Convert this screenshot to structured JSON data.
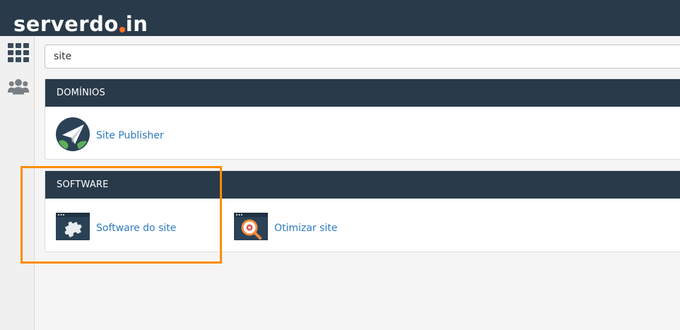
{
  "header": {
    "logo_text_before": "serverdo",
    "logo_text_after": "in",
    "bg_color": "#293a4a",
    "accent_color": "#ff6c2c"
  },
  "sidebar": {
    "items": [
      {
        "icon": "grid-icon"
      },
      {
        "icon": "users-icon"
      }
    ]
  },
  "search": {
    "value": "site"
  },
  "sections": [
    {
      "title": "DOMÍNIOS",
      "items": [
        {
          "label": "Site Publisher",
          "icon": "paper-plane-globe-icon"
        }
      ]
    },
    {
      "title": "SOFTWARE",
      "items": [
        {
          "label": "Software do site",
          "icon": "puzzle-window-icon"
        },
        {
          "label": "Otimizar site",
          "icon": "magnifier-window-icon"
        }
      ]
    }
  ],
  "colors": {
    "link": "#2e7bbf",
    "highlight_border": "#ff8c00"
  }
}
